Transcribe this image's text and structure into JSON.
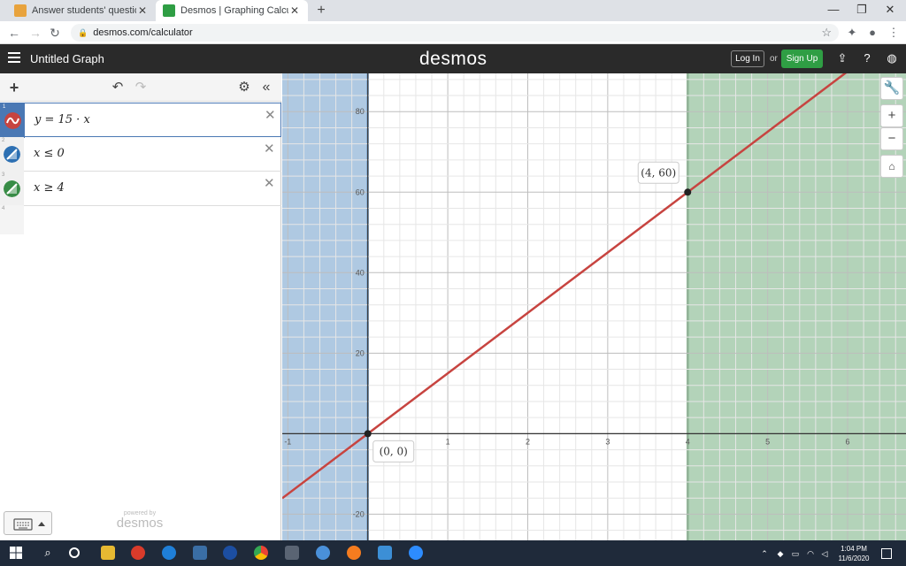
{
  "browser": {
    "tabs": [
      {
        "title": "Answer students' questions and e",
        "close": "✕",
        "active": false
      },
      {
        "title": "Desmos | Graphing Calculator",
        "close": "✕",
        "active": true
      }
    ],
    "new_tab": "+",
    "url": "desmos.com/calculator"
  },
  "header": {
    "graph_title": "Untitled Graph",
    "logo": "desmos",
    "login_label": "Log In",
    "or_label": "or",
    "signup_label": "Sign Up"
  },
  "expressions": [
    {
      "number": "1",
      "latex": "y = 15 · x",
      "color": "#c74440"
    },
    {
      "number": "2",
      "latex": "x ≤ 0",
      "color": "#2d70b3"
    },
    {
      "number": "3",
      "latex": "x ≥ 4",
      "color": "#388c46"
    }
  ],
  "empty_row_number": "4",
  "branding": {
    "powered_by": "powered by",
    "logo": "desmos"
  },
  "chart_data": {
    "type": "line",
    "xlim": [
      -1.07,
      6.73
    ],
    "ylim": [
      -26.5,
      89.5
    ],
    "x_ticks": [
      -1,
      1,
      2,
      3,
      4,
      5,
      6
    ],
    "y_ticks": [
      -20,
      20,
      40,
      60,
      80
    ],
    "grid": true,
    "series": [
      {
        "name": "y = 15 · x",
        "color": "#c74440",
        "x": [
          -1.07,
          6.73
        ],
        "y": [
          -16.05,
          100.95
        ]
      }
    ],
    "shaded_regions": [
      {
        "label": "x ≤ 0",
        "color": "#2d70b3",
        "x_from": -1.07,
        "x_to": 0
      },
      {
        "label": "x ≥ 4",
        "color": "#388c46",
        "x_from": 4,
        "x_to": 6.73
      }
    ],
    "points": [
      {
        "x": 0,
        "y": 0,
        "label": "(0, 0)"
      },
      {
        "x": 4,
        "y": 60,
        "label": "(4, 60)"
      }
    ]
  },
  "taskbar": {
    "time": "1:04 PM",
    "date": "11/6/2020"
  }
}
